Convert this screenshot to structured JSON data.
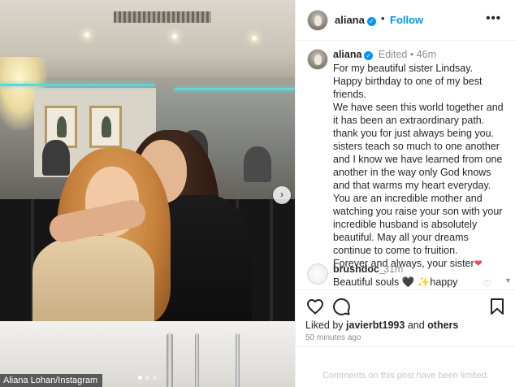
{
  "photo": {
    "credit": "Aliana Lohan/Instagram",
    "carousel_dots": 3,
    "active_dot": 0
  },
  "header": {
    "username": "aliana",
    "separator": "•",
    "follow_label": "Follow",
    "more_label": "•••"
  },
  "caption": {
    "username": "aliana",
    "meta": "Edited • 46m",
    "lines": [
      "For my beautiful sister Lindsay.",
      "Happy birthday to one of my best friends.",
      "We have seen this world together and it has been an extraordinary path. thank you for just always being you. sisters teach so much to one another and I know we have learned from one another in the way only God knows and that warms my heart everyday. You are an incredible mother and watching you raise your son with your incredible husband is absolutely beautiful. May all your dreams continue to come to fruition.",
      "Forever and always, your sister"
    ],
    "end_emoji": "❤"
  },
  "comment": {
    "username": "brushdoc_",
    "meta": "31m",
    "text": "Beautiful souls 🖤 ✨happy"
  },
  "actions": {
    "liked_by_prefix": "Liked by",
    "liked_by_user": "javierbt1993",
    "liked_by_and": "and",
    "liked_by_others": "others",
    "time": "50 minutes ago"
  },
  "footer": {
    "comments_limited": "Comments on this post have been limited."
  },
  "colors": {
    "accent": "#0095f6",
    "heart": "#ed4956",
    "muted": "#8e8e8e"
  }
}
